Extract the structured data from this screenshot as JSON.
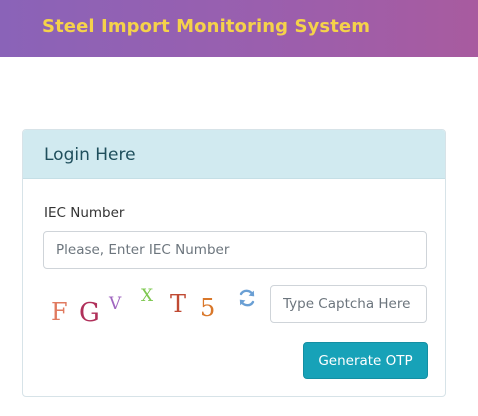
{
  "header": {
    "title": "Steel Import Monitoring System"
  },
  "login_card": {
    "title": "Login Here",
    "iec_label": "IEC Number",
    "iec_placeholder": "Please, Enter IEC Number",
    "iec_value": "",
    "captcha": {
      "characters": [
        "F",
        "G",
        "V",
        "X",
        "T",
        "5"
      ],
      "refresh_icon": "refresh-icon",
      "input_placeholder": "Type Captcha Here",
      "input_value": ""
    },
    "submit_label": "Generate OTP"
  },
  "colors": {
    "header_gradient_start": "#8a63b8",
    "header_gradient_end": "#a85b9f",
    "header_title": "#f5d24a",
    "card_header_bg": "#d1eaf0",
    "button_bg": "#17a2b8",
    "captcha_chars": [
      "#e07a5f",
      "#b0305a",
      "#a066c0",
      "#7ec850",
      "#c04a33",
      "#d9772a"
    ]
  }
}
